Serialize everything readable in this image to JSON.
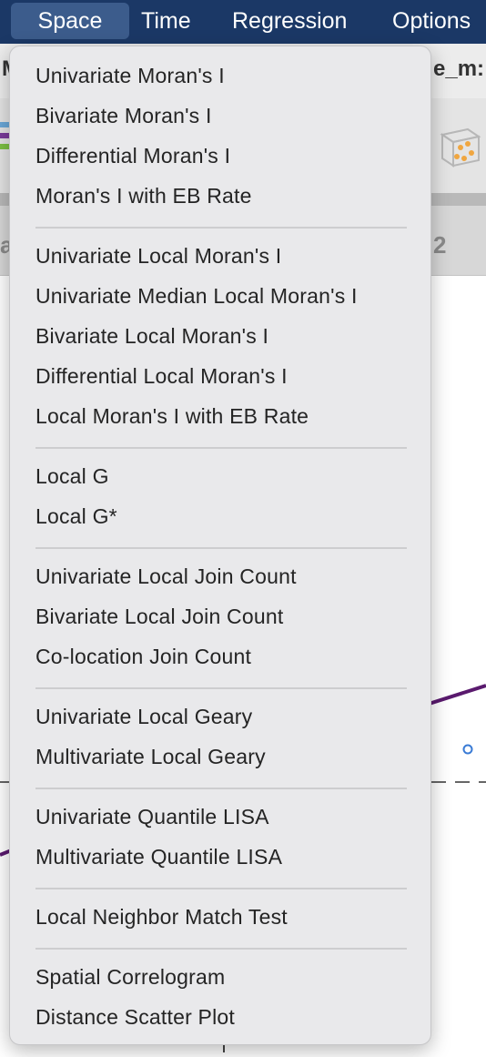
{
  "menubar": {
    "items": [
      "Space",
      "Time",
      "Regression",
      "Options"
    ]
  },
  "background": {
    "window_title_fragment": "M",
    "tab_fragment": "e_m:",
    "column_fragment_left": "a",
    "column_fragment_right": "2"
  },
  "space_menu": {
    "groups": [
      [
        "Univariate Moran's I",
        "Bivariate Moran's I",
        "Differential Moran's I",
        "Moran's I with EB Rate"
      ],
      [
        "Univariate Local Moran's I",
        "Univariate Median Local Moran's I",
        "Bivariate Local Moran's I",
        "Differential Local Moran's I",
        "Local Moran's I with EB Rate"
      ],
      [
        "Local G",
        "Local G*"
      ],
      [
        "Univariate Local Join Count",
        "Bivariate Local Join Count",
        "Co-location Join Count"
      ],
      [
        "Univariate Local Geary",
        "Multivariate Local Geary"
      ],
      [
        "Univariate Quantile LISA",
        "Multivariate Quantile LISA"
      ],
      [
        "Local Neighbor Match Test"
      ],
      [
        "Spatial Correlogram",
        "Distance Scatter Plot"
      ]
    ]
  },
  "colors": {
    "menubar_bg": "#1b3866",
    "menubar_active": "#3c5c8c",
    "menu_bg": "#e9e9eb",
    "menu_text": "#242424",
    "plot_line": "#5a1a6e",
    "plot_point": "#3a7bd5"
  }
}
